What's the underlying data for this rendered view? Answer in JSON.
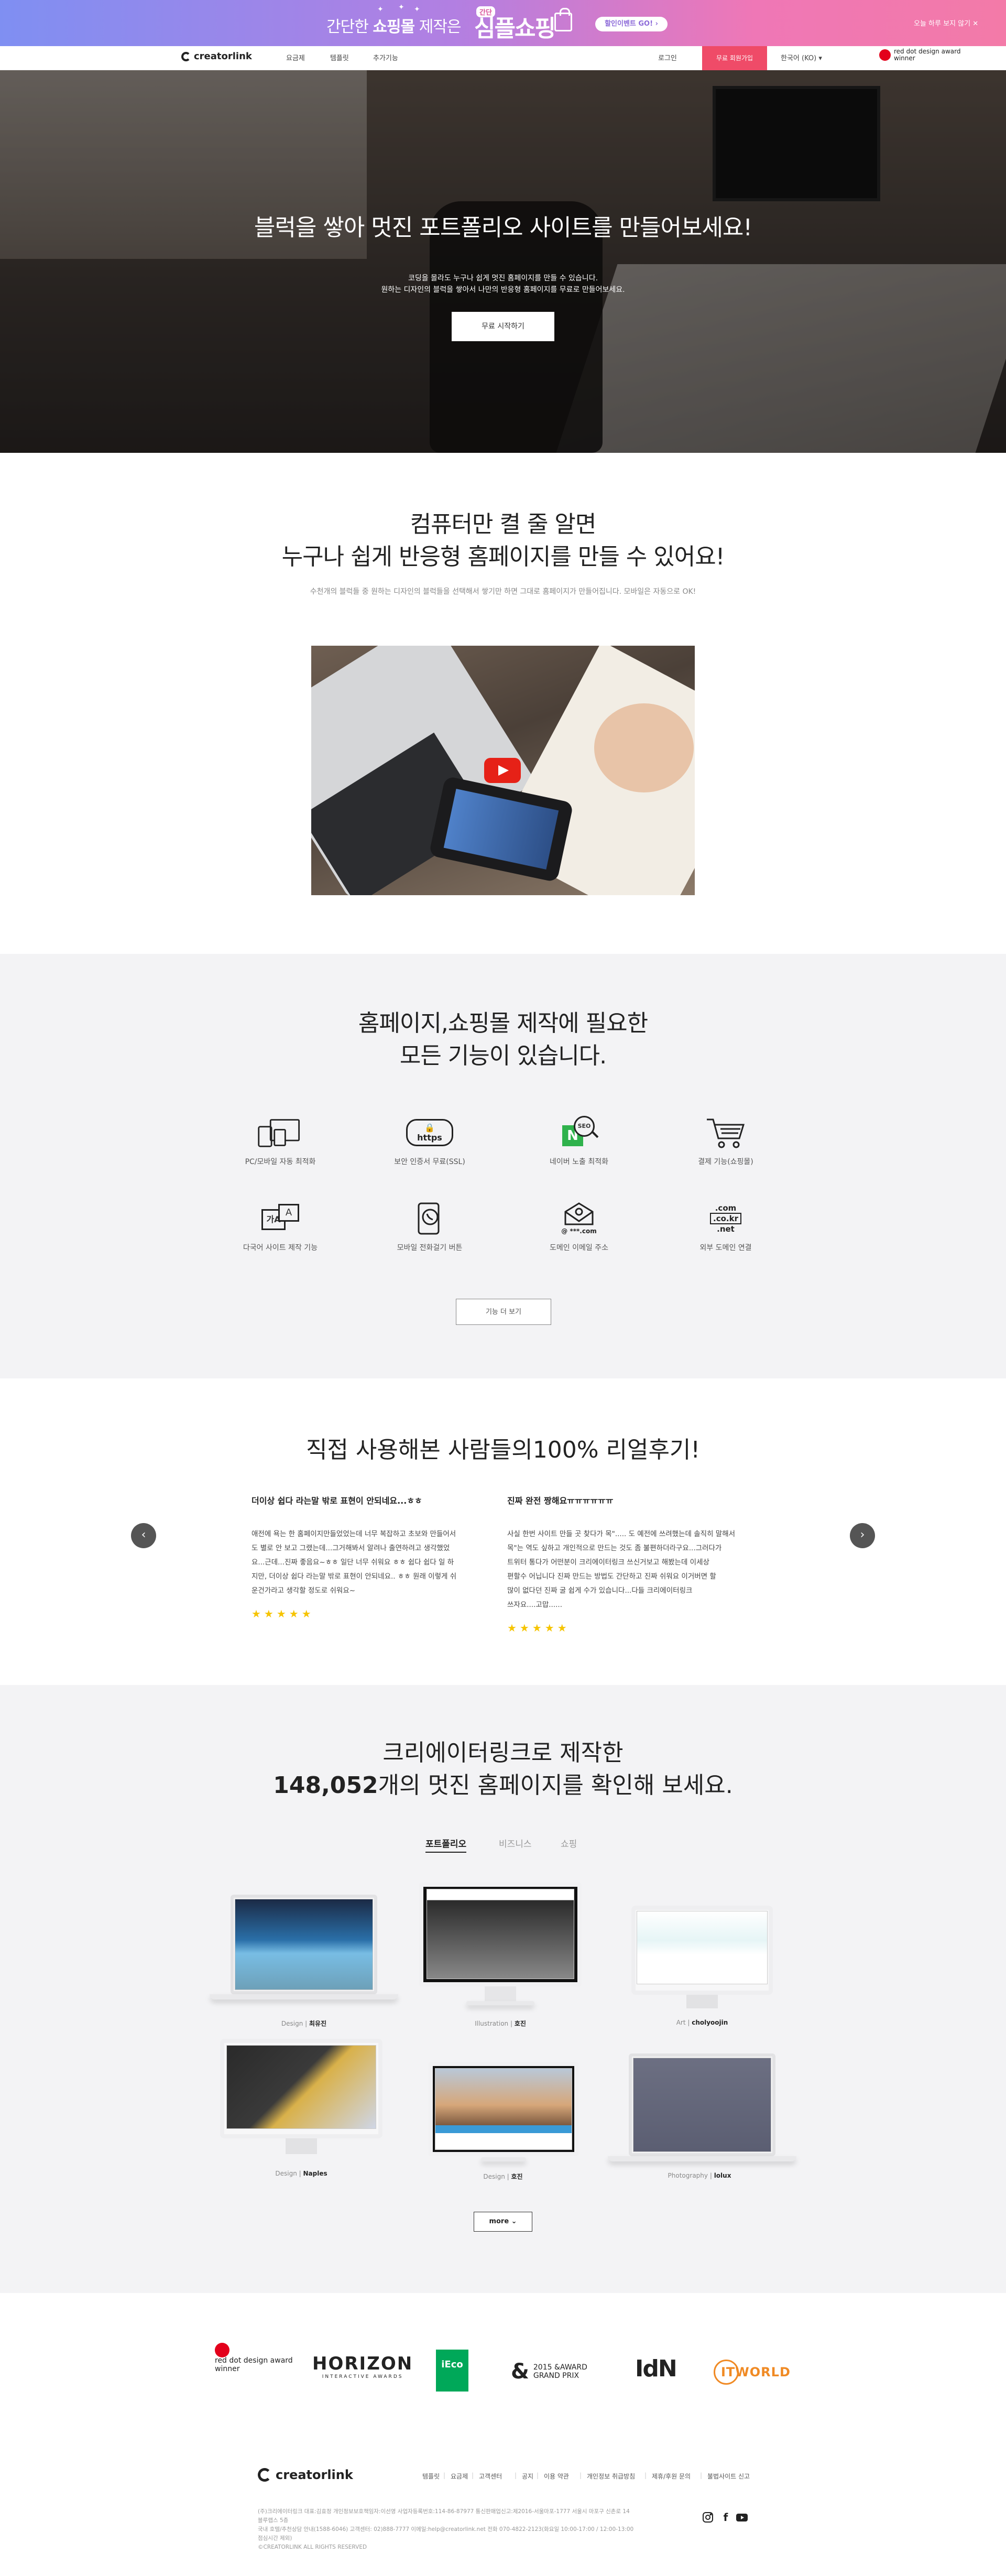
{
  "promo": {
    "text_prefix": "간단한",
    "text_bold": "쇼핑몰",
    "text_suffix": "제작은",
    "badge": "간단",
    "big": "심플쇼핑",
    "button": "할인이벤트 GO! ›",
    "hide": "오늘 하루 보지 않기 ✕"
  },
  "nav": {
    "logo": "creatorlink",
    "links": [
      "요금제",
      "템플릿",
      "추가기능"
    ],
    "login": "로그인",
    "signup": "무료 회원가입",
    "lang": "한국어 (KO)",
    "award_line1": "red dot design award",
    "award_line2": "winner"
  },
  "hero": {
    "title": "블럭을 쌓아 멋진 포트폴리오 사이트를 만들어보세요!",
    "sub1": "코딩을 몰라도 누구나 쉽게 멋진 홈페이지를 만들 수 있습니다.",
    "sub2": "원하는 디자인의 블럭을 쌓아서 나만의 반응형 홈페이지를 무료로 만들어보세요.",
    "button": "무료 시작하기"
  },
  "intro": {
    "title1": "컴퓨터만 켤 줄 알면",
    "title2": "누구나 쉽게 반응형 홈페이지를 만들 수 있어요!",
    "desc": "수천개의 블럭들 중 원하는 디자인의 블럭들을 선택해서 쌓기만 하면 그대로 홈페이지가 만들어집니다. 모바일은 자동으로 OK!"
  },
  "features": {
    "title1": "홈페이지,쇼핑몰 제작에 필요한",
    "title2": "모든 기능이 있습니다.",
    "items": [
      {
        "label": "PC/모바일 자동 최적화",
        "icon": "devices-icon"
      },
      {
        "label": "보안 인증서 무료(SSL)",
        "icon": "https-icon",
        "icon_text": "https"
      },
      {
        "label": "네이버 노출 최적화",
        "icon": "naver-seo-icon",
        "icon_text": "SEO"
      },
      {
        "label": "결제 기능(쇼핑몰)",
        "icon": "cart-icon"
      },
      {
        "label": "다국어 사이트 제작 기능",
        "icon": "translate-icon",
        "icon_text": "가A"
      },
      {
        "label": "모바일 전화걸기 버튼",
        "icon": "phone-call-icon"
      },
      {
        "label": "도메인 이메일 주소",
        "icon": "email-icon",
        "icon_text": "@ ***.com"
      },
      {
        "label": "외부 도메인 연결",
        "icon": "domain-icon",
        "icon_text": [
          ".com",
          ".co.kr",
          ".net"
        ]
      }
    ],
    "more": "기능 더 보기"
  },
  "reviews": {
    "title": "직접 사용해본 사람들의100% 리얼후기!",
    "items": [
      {
        "title": "더이상 쉽다 라는말 밖로 표현이 안되네요...ㅎㅎ",
        "lines": [
          "애전에 욕는 한 홈페이지만들었었는데 너무 복잡하고 초보와 만들어서",
          "도 별로 안 보고 그랬는데...그거해봐서 알려나 출연하려고 생각했었",
          "요...근데...진짜 좋음요~ㅎㅎ 일단 너무 쉬워요 ㅎㅎ 쉽다 쉽다 일 하",
          "지만, 더이상 쉽다 라는말 밖로 표현이 안되네요.. ㅎㅎ 원래 이렇게 쉬",
          "운건가라고 생각할 정도로 쉬워요~"
        ],
        "stars": "★★★★★"
      },
      {
        "title": "진짜 완전 짱해요ㅠㅠㅠㅠㅠㅠ",
        "lines": [
          "사실 한번 사이트 만들 곳 찾다가 목\"..... 도 예전에 쓰려했는데 솔직히 말해서",
          "목\"는 역도 싶하고 개인적으로 만드는 것도 좀 불편하더라구요...그러다가",
          "트위터 통다가 어떤분이 크리에이터링크 쓰신거보고 해봤는데 이세상",
          "편할수 어닙니다 진짜 만드는 방법도 간단하고 진짜 쉬워요 이거버면 할",
          "많이 없다던 진짜 굴 쉽게 수가 있습니다...다들 크리에이터링크",
          "쓰자요....고맙......"
        ],
        "stars": "★★★★★"
      }
    ]
  },
  "showcase": {
    "title1": "크리에이터링크로 제작한",
    "count": "148,052",
    "title2_suffix": "개의 멋진 홈페이지를 확인해 보세요.",
    "tabs": [
      "포트폴리오",
      "비즈니스",
      "쇼핑"
    ],
    "items": [
      {
        "category": "Design",
        "name": "최유진"
      },
      {
        "category": "Illustration",
        "name": "호진"
      },
      {
        "category": "Art",
        "name": "cholyoojin"
      },
      {
        "category": "Design",
        "name": "Naples"
      },
      {
        "category": "Design",
        "name": "호진"
      },
      {
        "category": "Photography",
        "name": "lolux"
      }
    ],
    "more": "more ⌄"
  },
  "awards": [
    {
      "name": "reddot",
      "line1": "red dot design award",
      "line2": "winner"
    },
    {
      "name": "horizon",
      "line1": "HORIZON",
      "line2": "INTERACTIVE AWARDS"
    },
    {
      "name": "ieco",
      "line1": "iEco"
    },
    {
      "name": "2015 & award grand prix",
      "line1": "2015 &AWARD",
      "line2": "GRAND PRIX"
    },
    {
      "name": "idn",
      "line1": "IdN"
    },
    {
      "name": "itworld",
      "line1": "ITWORLD"
    }
  ],
  "footer": {
    "logo": "creatorlink",
    "links": [
      "템플릿",
      "요금제",
      "고객센터",
      "공지",
      "이용 약관",
      "개인정보 취급방침",
      "제휴/후원 문의",
      "불법사이트 신고"
    ],
    "info1": "(주)크리에이터링크 대표:김효정 개인정보보호책임자:이선영 사업자등록번호:114-86-87977 통신판매업신고:제2016-서울마포-1777 서울시 마포구 신촌로 14 블루랩스 5층",
    "info2": "국내 호텔/추천상담 안내(1588-6046) 고객센터: 02)888-7777 이메일:help@creatorlink.net 전화 070-4822-2123(화요일 10:00-17:00 / 12:00-13:00 점심시간 제외)",
    "copyright": "©CREATORLINK ALL RIGHTS RESERVED"
  },
  "colors": {
    "accent": "#ef4b68",
    "promo_start": "#7f8ff2",
    "promo_end": "#f37aa8",
    "star": "#f6c400"
  }
}
